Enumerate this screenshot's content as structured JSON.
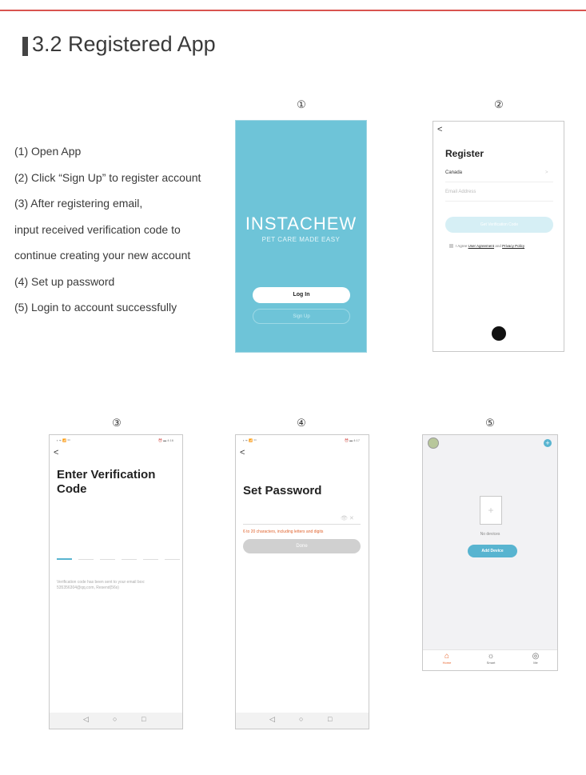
{
  "section": {
    "title": "3.2 Registered App"
  },
  "instructions": [
    "(1) Open App",
    "(2) Click “Sign Up” to register account",
    "(3) After registering email,",
    "input received verification code to",
    "continue creating your new account",
    "(4) Set up password",
    "(5) Login to account successfully"
  ],
  "step_numbers": [
    "①",
    "②",
    "③",
    "④",
    "⑤"
  ],
  "screen1": {
    "logo": "INSTACHEW",
    "tagline": "PET CARE MADE EASY",
    "login_label": "Log In",
    "signup_label": "Sign Up"
  },
  "screen2": {
    "back": "<",
    "title": "Register",
    "country": "Canada",
    "country_arrow": ">",
    "email_placeholder": "Email Address",
    "verify_label": "Get Verification Code",
    "agree_prefix": "I Agree",
    "user_agreement": "User Agreement",
    "and": "and",
    "privacy_policy": "Privacy Policy",
    "apple_icon": ""
  },
  "screen3": {
    "status_left": "▪ ᯤ 📶 ⁸⁸",
    "status_right": "⏰ ▬ 4:16",
    "back": "<",
    "title": "Enter Verification Code",
    "info": "Verification code has been sent to your email box: 535356304@qq.com, Resend(56s)"
  },
  "screen4": {
    "status_left": "▪ ᯤ 📶 ⁸⁸",
    "status_right": "⏰ ▬ 4:17",
    "back": "<",
    "title": "Set Password",
    "field_icons": "👁  ✕",
    "hint": "6 to 20 characters, including letters and digits",
    "done_label": "Done"
  },
  "nav_buttons": {
    "back": "◁",
    "home": "○",
    "recent": "□"
  },
  "screen5": {
    "add_icon": "+",
    "doc_icon": "+",
    "empty_label": "No devices",
    "add_device_label": "Add Device",
    "tabs": [
      {
        "icon": "⌂",
        "label": "Home",
        "color": "#e8632b"
      },
      {
        "icon": "☼",
        "label": "Smart",
        "color": "#666666"
      },
      {
        "icon": "◎",
        "label": "Me",
        "color": "#666666"
      }
    ]
  }
}
